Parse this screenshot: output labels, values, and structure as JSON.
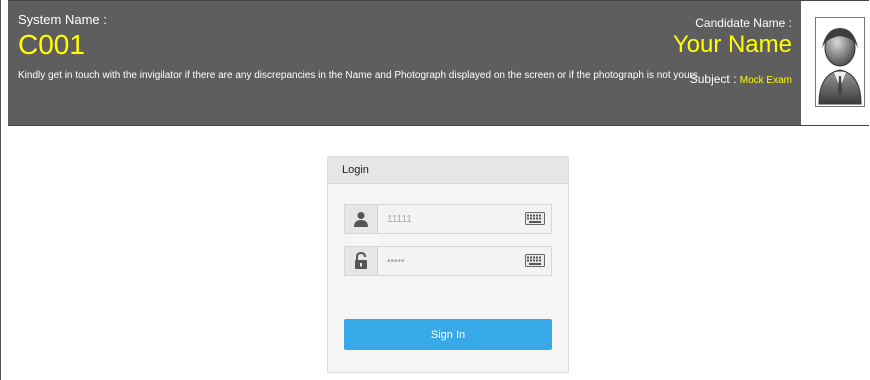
{
  "header": {
    "system_label": "System Name :",
    "system_value": "C001",
    "notice": "Kindly get in touch with the invigilator if there are any discrepancies in the Name and Photograph displayed on the screen or if the photograph is not yours",
    "candidate_label": "Candidate Name :",
    "candidate_value": "Your Name",
    "subject_label": "Subject :",
    "subject_value": "Mock Exam",
    "colors": {
      "bar": "#5e5e5e",
      "highlight": "#ffff00"
    }
  },
  "login": {
    "title": "Login",
    "username_value": "11111",
    "password_value": "•••••",
    "sign_in_label": "Sign In",
    "icons": [
      "user-icon",
      "lock-icon",
      "keyboard-icon"
    ],
    "button_color": "#37a9e6"
  }
}
